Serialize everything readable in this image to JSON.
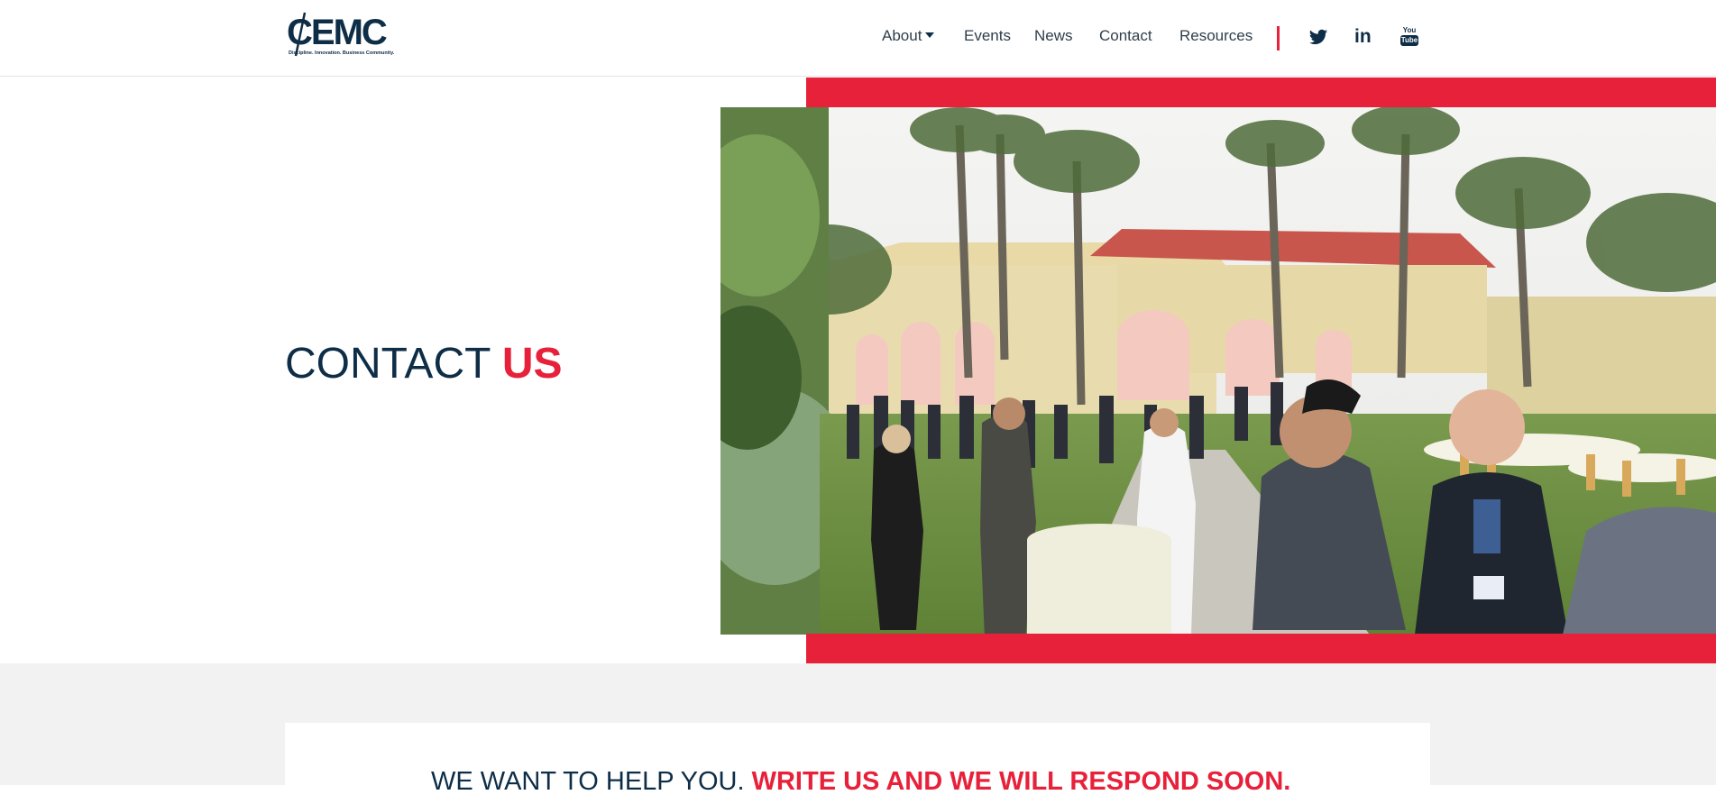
{
  "header": {
    "logo_text": "CEMC",
    "logo_tagline": "Discipline. Innovation. Business Community.",
    "nav": {
      "about": "About",
      "events": "Events",
      "news": "News",
      "contact": "Contact",
      "resources": "Resources"
    },
    "social_icons": [
      "twitter-icon",
      "linkedin-icon",
      "youtube-icon"
    ],
    "youtube_small": "You",
    "youtube_big": "Tube",
    "linkedin_text": "in"
  },
  "hero": {
    "title_part1": "CONTACT ",
    "title_part2": "US",
    "image": "outdoor-networking-event-photo"
  },
  "card": {
    "heading_part1": "WE WANT TO HELP YOU. ",
    "heading_part2": "WRITE US AND WE WILL RESPOND SOON."
  },
  "colors": {
    "navy": "#0e2d47",
    "red": "#e8213a",
    "section_gray": "#f2f2f2"
  }
}
